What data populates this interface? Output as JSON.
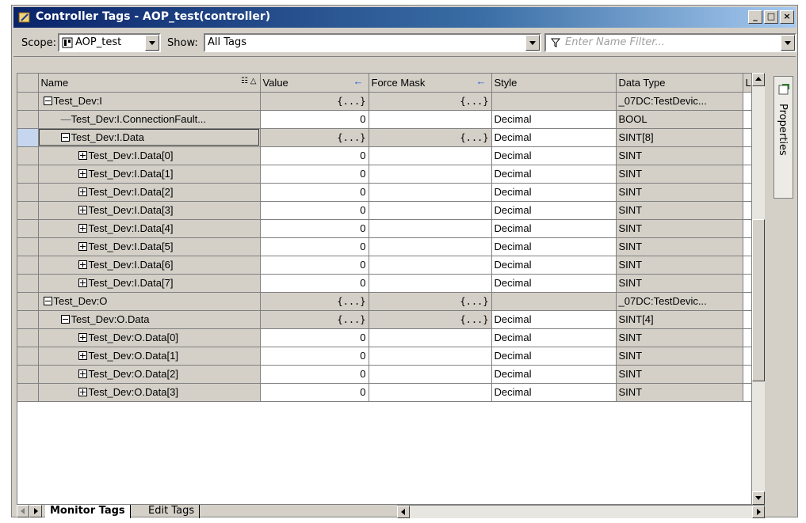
{
  "window": {
    "title": "Controller Tags - AOP_test(controller)"
  },
  "toolbar": {
    "scope_label": "Scope:",
    "scope_value": "AOP_test",
    "show_label": "Show:",
    "show_value": "All Tags",
    "filter_placeholder": "Enter Name Filter..."
  },
  "columns": {
    "name": "Name",
    "value": "Value",
    "force_mask": "Force Mask",
    "style": "Style",
    "data_type": "Data Type"
  },
  "rows": [
    {
      "name": "Test_Dev:I",
      "value": "{...}",
      "force": "{...}",
      "style": "",
      "type": "_07DC:TestDevic...",
      "level": 0,
      "toggle": "minus"
    },
    {
      "name": "Test_Dev:I.ConnectionFault...",
      "value": "0",
      "force": "",
      "style": "Decimal",
      "type": "BOOL",
      "level": 1,
      "toggle": "none"
    },
    {
      "name": "Test_Dev:I.Data",
      "value": "{...}",
      "force": "{...}",
      "style": "Decimal",
      "type": "SINT[8]",
      "level": 1,
      "toggle": "minus"
    },
    {
      "name": "Test_Dev:I.Data[0]",
      "value": "0",
      "force": "",
      "style": "Decimal",
      "type": "SINT",
      "level": 2,
      "toggle": "plus"
    },
    {
      "name": "Test_Dev:I.Data[1]",
      "value": "0",
      "force": "",
      "style": "Decimal",
      "type": "SINT",
      "level": 2,
      "toggle": "plus"
    },
    {
      "name": "Test_Dev:I.Data[2]",
      "value": "0",
      "force": "",
      "style": "Decimal",
      "type": "SINT",
      "level": 2,
      "toggle": "plus"
    },
    {
      "name": "Test_Dev:I.Data[3]",
      "value": "0",
      "force": "",
      "style": "Decimal",
      "type": "SINT",
      "level": 2,
      "toggle": "plus"
    },
    {
      "name": "Test_Dev:I.Data[4]",
      "value": "0",
      "force": "",
      "style": "Decimal",
      "type": "SINT",
      "level": 2,
      "toggle": "plus"
    },
    {
      "name": "Test_Dev:I.Data[5]",
      "value": "0",
      "force": "",
      "style": "Decimal",
      "type": "SINT",
      "level": 2,
      "toggle": "plus"
    },
    {
      "name": "Test_Dev:I.Data[6]",
      "value": "0",
      "force": "",
      "style": "Decimal",
      "type": "SINT",
      "level": 2,
      "toggle": "plus"
    },
    {
      "name": "Test_Dev:I.Data[7]",
      "value": "0",
      "force": "",
      "style": "Decimal",
      "type": "SINT",
      "level": 2,
      "toggle": "plus"
    },
    {
      "name": "Test_Dev:O",
      "value": "{...}",
      "force": "{...}",
      "style": "",
      "type": "_07DC:TestDevic...",
      "level": 0,
      "toggle": "minus"
    },
    {
      "name": "Test_Dev:O.Data",
      "value": "{...}",
      "force": "{...}",
      "style": "Decimal",
      "type": "SINT[4]",
      "level": 1,
      "toggle": "minus"
    },
    {
      "name": "Test_Dev:O.Data[0]",
      "value": "0",
      "force": "",
      "style": "Decimal",
      "type": "SINT",
      "level": 2,
      "toggle": "plus"
    },
    {
      "name": "Test_Dev:O.Data[1]",
      "value": "0",
      "force": "",
      "style": "Decimal",
      "type": "SINT",
      "level": 2,
      "toggle": "plus"
    },
    {
      "name": "Test_Dev:O.Data[2]",
      "value": "0",
      "force": "",
      "style": "Decimal",
      "type": "SINT",
      "level": 2,
      "toggle": "plus"
    },
    {
      "name": "Test_Dev:O.Data[3]",
      "value": "0",
      "force": "",
      "style": "Decimal",
      "type": "SINT",
      "level": 2,
      "toggle": "plus"
    }
  ],
  "selected_row": 2,
  "side_panel": {
    "label": "Properties"
  },
  "tabs": {
    "monitor": "Monitor Tags",
    "edit": "Edit Tags"
  }
}
